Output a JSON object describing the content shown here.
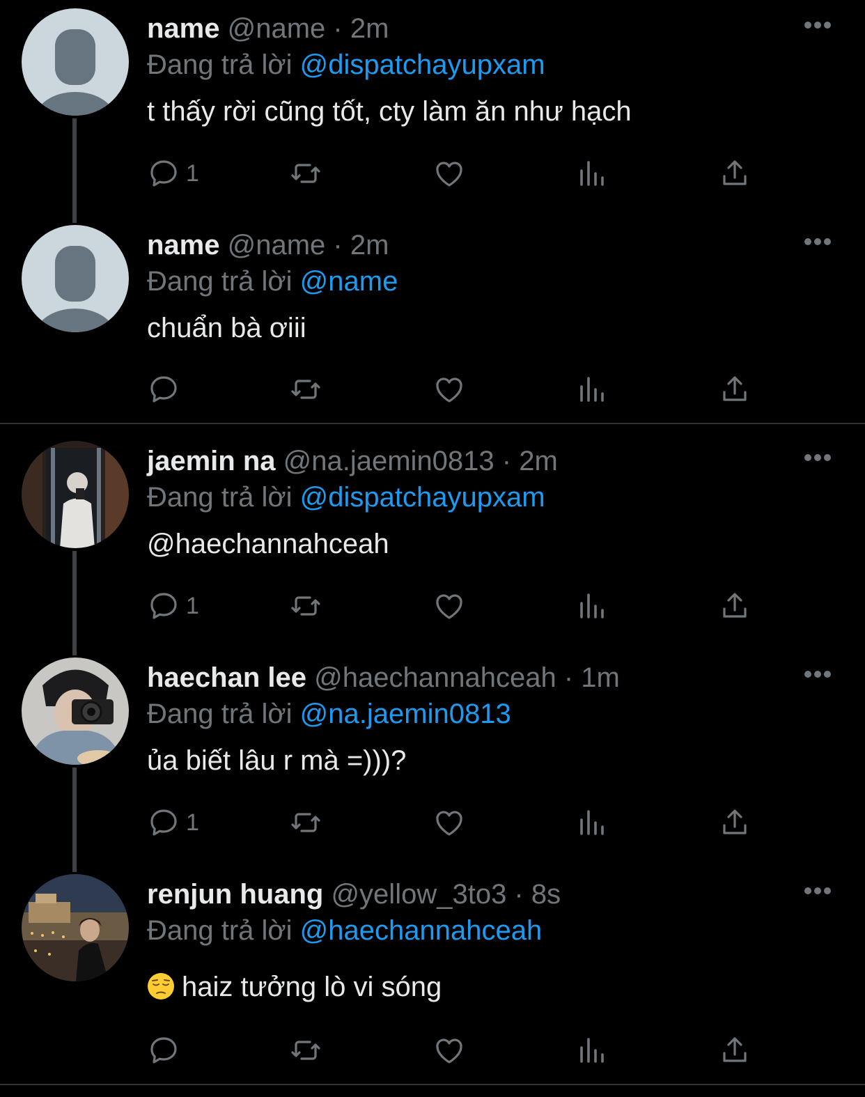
{
  "colors": {
    "background": "#000000",
    "text": "#e7e9ea",
    "muted": "#71767b",
    "accent": "#1d9bf0",
    "thread_line": "#3e4144"
  },
  "reply_prefix": "Đang trả lời",
  "tweets": [
    {
      "name": "name",
      "handle": "@name",
      "sep": " · ",
      "time": "2m",
      "reply_to": "@dispatchayupxam",
      "text": "t thấy rời cũng tốt, cty làm ăn như hạch",
      "reply_count": "1",
      "avatar": "default-avatar"
    },
    {
      "name": "name",
      "handle": "@name",
      "sep": " · ",
      "time": "2m",
      "reply_to": "@name",
      "text": "chuẩn bà ơiii",
      "reply_count": "",
      "avatar": "default-avatar"
    },
    {
      "name": "jaemin na",
      "handle": "@na.jaemin0813",
      "sep": " · ",
      "time": "2m",
      "reply_to": "@dispatchayupxam",
      "text": "@haechannahceah",
      "reply_count": "1",
      "avatar": "photo-avatar"
    },
    {
      "name": "haechan lee",
      "handle": "@haechannahceah",
      "sep": " · ",
      "time": "1m",
      "reply_to": "@na.jaemin0813",
      "text": "ủa biết lâu r mà =)))?",
      "reply_count": "1",
      "avatar": "photo-avatar"
    },
    {
      "name": "renjun huang",
      "handle": "@yellow_3to3",
      "sep": " · ",
      "time": "8s",
      "reply_to": "@haechannahceah",
      "text": "haiz tưởng lò vi sóng",
      "reply_count": "",
      "avatar": "photo-avatar",
      "emoji": "pensive-face"
    }
  ]
}
